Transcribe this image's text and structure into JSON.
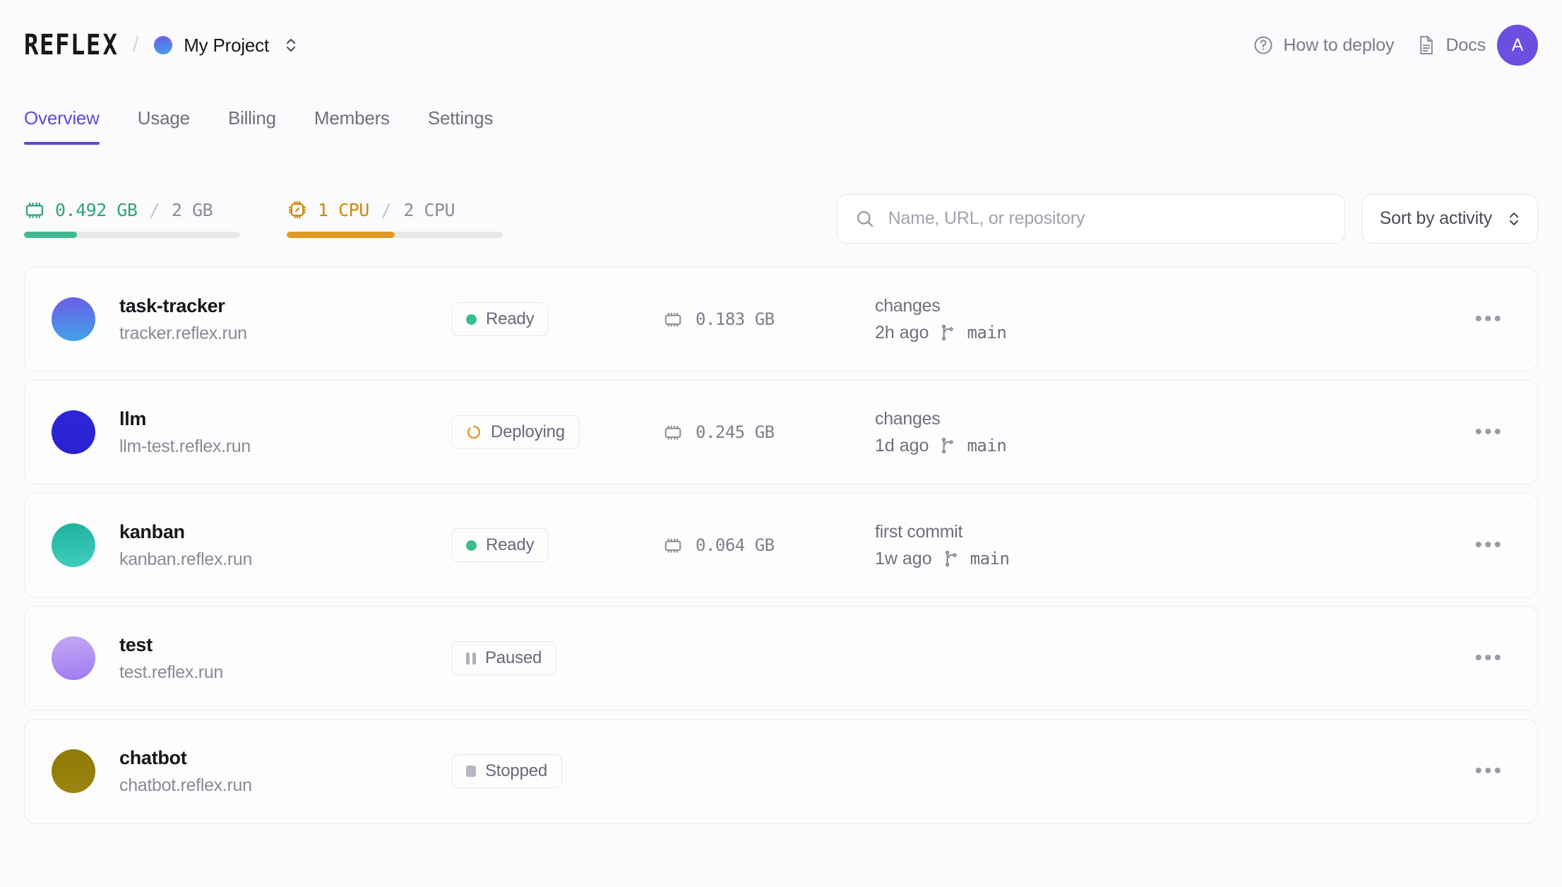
{
  "header": {
    "logo": "REFLEX",
    "breadcrumb_separator": "/",
    "project_name": "My Project",
    "how_to_deploy": "How to deploy",
    "docs": "Docs",
    "avatar_initial": "A",
    "accent_color": "#5c4ad8",
    "avatar_color": "#6c4ee0"
  },
  "tabs": [
    {
      "label": "Overview",
      "active": true
    },
    {
      "label": "Usage",
      "active": false
    },
    {
      "label": "Billing",
      "active": false
    },
    {
      "label": "Members",
      "active": false
    },
    {
      "label": "Settings",
      "active": false
    }
  ],
  "meters": {
    "memory": {
      "used": "0.492 GB",
      "separator": "/",
      "total": "2 GB",
      "percent": 24.6,
      "color": "#44b892"
    },
    "cpu": {
      "used": "1 CPU",
      "separator": "/",
      "total": "2 CPU",
      "percent": 50,
      "color": "#e09a22"
    }
  },
  "search": {
    "value": "",
    "placeholder": "Name, URL, or repository"
  },
  "sort": {
    "label": "Sort by activity"
  },
  "apps": [
    {
      "name": "task-tracker",
      "url": "tracker.reflex.run",
      "status": "Ready",
      "status_type": "ready",
      "memory": "0.183 GB",
      "commit_message": "changes",
      "commit_time": "2h ago",
      "branch": "main",
      "avatar_from": "#6d5ce8",
      "avatar_to": "#3fa4e8"
    },
    {
      "name": "llm",
      "url": "llm-test.reflex.run",
      "status": "Deploying",
      "status_type": "deploying",
      "memory": "0.245 GB",
      "commit_message": "changes",
      "commit_time": "1d ago",
      "branch": "main",
      "avatar_from": "#2e27d8",
      "avatar_to": "#2a22cf"
    },
    {
      "name": "kanban",
      "url": "kanban.reflex.run",
      "status": "Ready",
      "status_type": "ready",
      "memory": "0.064 GB",
      "commit_message": "first commit",
      "commit_time": "1w ago",
      "branch": "main",
      "avatar_from": "#22b09d",
      "avatar_to": "#3fcfc0"
    },
    {
      "name": "test",
      "url": "test.reflex.run",
      "status": "Paused",
      "status_type": "paused",
      "memory": "",
      "commit_message": "",
      "commit_time": "",
      "branch": "",
      "avatar_from": "#c3a8f5",
      "avatar_to": "#9f7cf0"
    },
    {
      "name": "chatbot",
      "url": "chatbot.reflex.run",
      "status": "Stopped",
      "status_type": "stopped",
      "memory": "",
      "commit_message": "",
      "commit_time": "",
      "branch": "",
      "avatar_from": "#8f7a07",
      "avatar_to": "#9a8510"
    }
  ],
  "icons": {
    "help": "question-circle-icon",
    "docs": "document-icon",
    "search": "search-icon",
    "sort": "chevron-up-down-icon",
    "memory": "memory-chip-icon",
    "cpu": "cpu-chip-icon",
    "branch": "git-branch-icon",
    "menu": "ellipsis-icon"
  },
  "status_colors": {
    "ready": "#3bbd8b",
    "deploying": "#e09a22",
    "paused": "#b0b0bd",
    "stopped": "#b7b7c2"
  }
}
